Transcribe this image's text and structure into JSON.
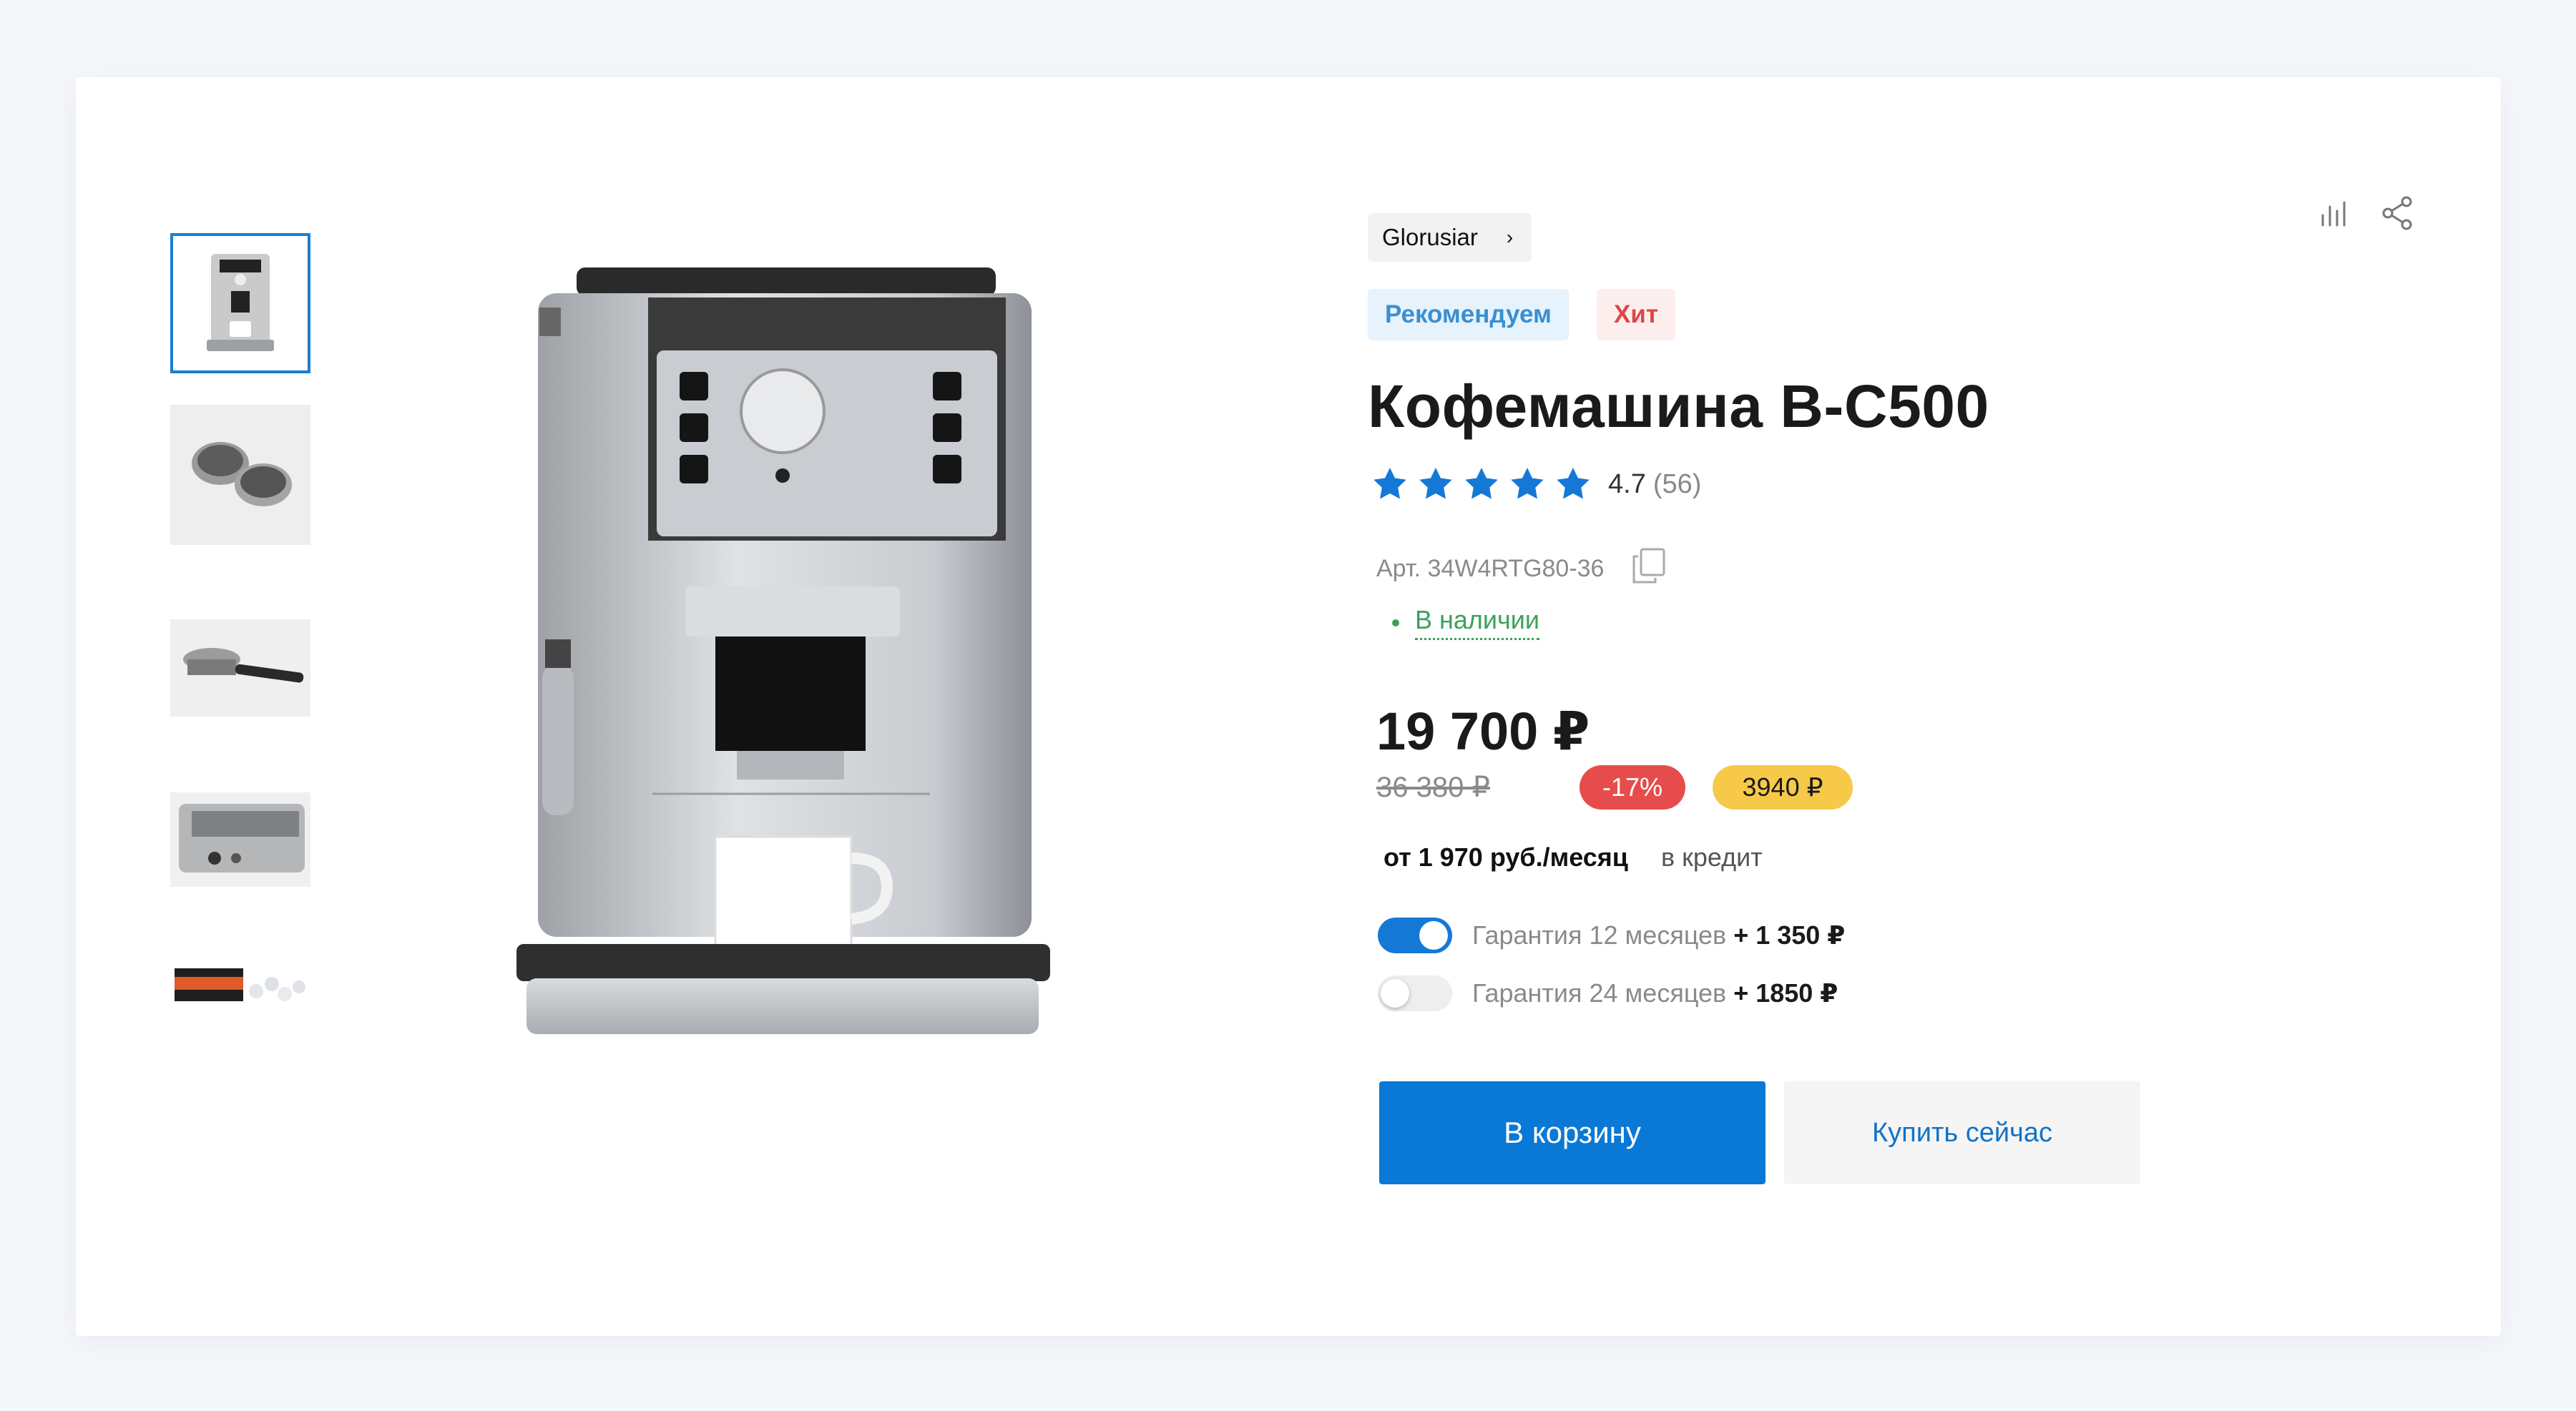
{
  "product": {
    "brand": "Glorusiar",
    "badges": {
      "recommended": "Рекомендуем",
      "hit": "Хит"
    },
    "title": "Кофемашина B-C500",
    "rating": {
      "value": "4.7",
      "count": "(56)",
      "stars": 5
    },
    "sku": "Арт. 34W4RTG80-36",
    "stock": "В наличии",
    "price": "19 700 ₽",
    "old_price": "36 380 ₽",
    "discount": "-17%",
    "bonus": "3940 ₽",
    "credit": {
      "amount": "от 1 970 руб./месяц",
      "label": "в кредит"
    },
    "warranty": [
      {
        "label": "Гарантия 12 месяцев",
        "price": "+ 1 350 ₽",
        "enabled": true
      },
      {
        "label": "Гарантия 24 месяцев",
        "price": "+ 1850 ₽",
        "enabled": false
      }
    ]
  },
  "actions": {
    "add_to_cart": "В корзину",
    "buy_now": "Купить сейчас"
  },
  "gallery": {
    "thumbnails": [
      "coffee-machine",
      "filter-baskets",
      "portafilter",
      "drip-tray",
      "descaling-tablets"
    ],
    "selected_index": 0
  },
  "icons": {
    "compare": "compare-icon",
    "share": "share-icon",
    "copy": "copy-icon",
    "brand_chevron": "chevron-right-icon"
  },
  "colors": {
    "accent": "#0a79d6",
    "star": "#1479d6",
    "in_stock": "#3aa15a",
    "discount": "#e64c4c",
    "bonus": "#f7c948"
  }
}
